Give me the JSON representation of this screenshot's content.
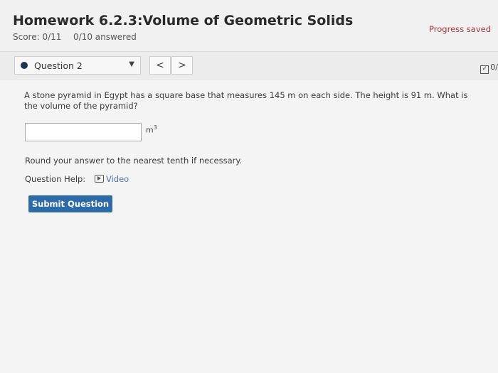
{
  "header": {
    "title": "Homework 6.2.3:Volume of Geometric Solids",
    "score": "Score: 0/11",
    "answered": "0/10 answered",
    "progress": "Progress saved"
  },
  "question_bar": {
    "current_question": "Question 2",
    "prev_label": "<",
    "next_label": ">",
    "status_text": "0/"
  },
  "question": {
    "text": "A stone pyramid in Egypt has a square base that measures 145 m on each side. The height is 91 m. What is the volume of the pyramid?",
    "answer_value": "",
    "unit": "m",
    "unit_exponent": "3",
    "instruction": "Round your answer to the nearest tenth if necessary.",
    "help_label": "Question Help:",
    "video_label": "Video",
    "submit_label": "Submit Question"
  },
  "colors": {
    "accent": "#2d6aa8",
    "link": "#4472b8",
    "progress": "#a03a3a"
  },
  "icons": [
    "dropdown-caret-icon",
    "checkbox-icon",
    "video-icon"
  ]
}
